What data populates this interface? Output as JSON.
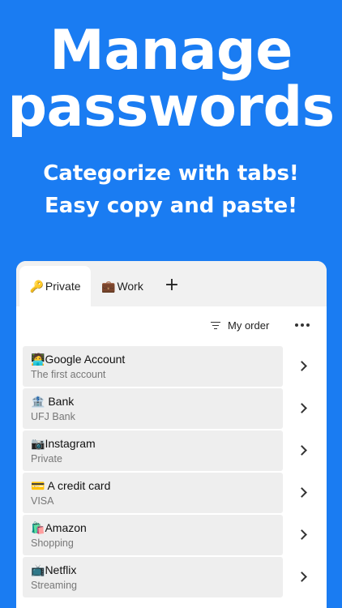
{
  "hero": {
    "title_line1": "Manage",
    "title_line2": "passwords",
    "sub_line1": "Categorize with tabs!",
    "sub_line2": "Easy copy and paste!"
  },
  "tabs": [
    {
      "emoji": "🔑",
      "label": "Private",
      "active": true
    },
    {
      "emoji": "💼",
      "label": "Work",
      "active": false
    }
  ],
  "add_tab_label": "+",
  "toolbar": {
    "sort_label": "My order"
  },
  "items": [
    {
      "emoji": "🧑‍💻",
      "title": "Google Account",
      "subtitle": "The first account"
    },
    {
      "emoji": "🏦",
      "title": " Bank",
      "subtitle": "UFJ Bank"
    },
    {
      "emoji": "📷",
      "title": "Instagram",
      "subtitle": "Private"
    },
    {
      "emoji": "💳",
      "title": " A credit card",
      "subtitle": "VISA"
    },
    {
      "emoji": "🛍️",
      "title": "Amazon",
      "subtitle": "Shopping"
    },
    {
      "emoji": "📺",
      "title": "Netflix",
      "subtitle": "Streaming"
    }
  ],
  "colors": {
    "background": "#1a7cf2",
    "card": "#ffffff",
    "row": "#eeeeee"
  }
}
